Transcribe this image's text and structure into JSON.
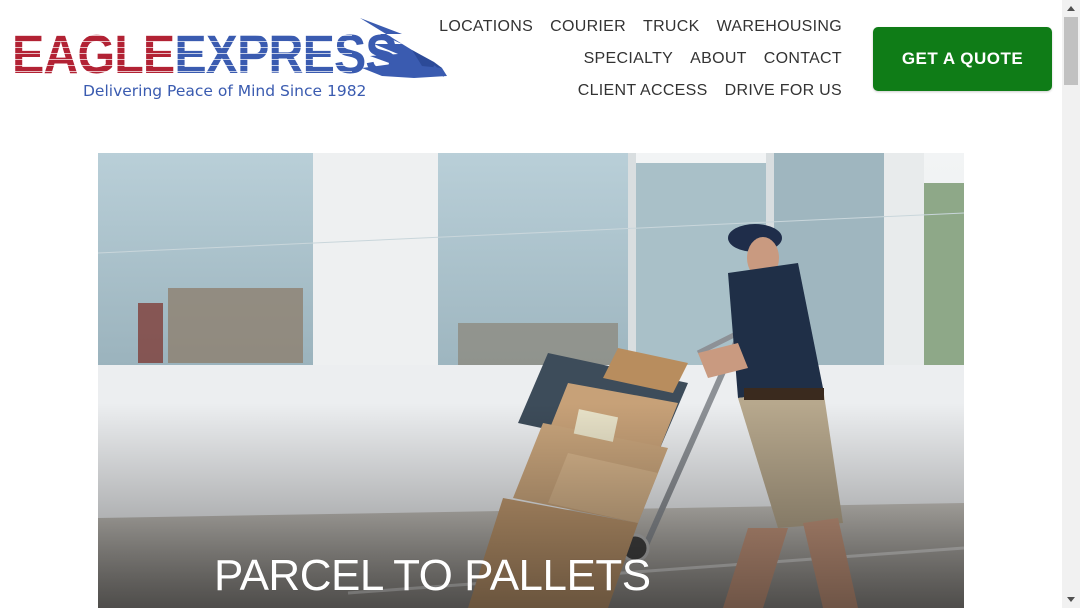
{
  "logo": {
    "word_part1": "EAGLE",
    "word_part2": "EXPRESS",
    "tagline": "Delivering Peace of Mind Since 1982",
    "colors": {
      "red": "#b22234",
      "blue": "#3a5bb0"
    }
  },
  "nav": {
    "row1": [
      "LOCATIONS",
      "COURIER",
      "TRUCK",
      "WAREHOUSING"
    ],
    "row2": [
      "SPECIALTY",
      "ABOUT",
      "CONTACT"
    ],
    "row3": [
      "CLIENT ACCESS",
      "DRIVE FOR US"
    ]
  },
  "cta": {
    "label": "GET A QUOTE",
    "color": "#0f7c17"
  },
  "hero": {
    "title": "PARCEL TO PALLETS",
    "image": "delivery-man-hand-truck-photo"
  }
}
